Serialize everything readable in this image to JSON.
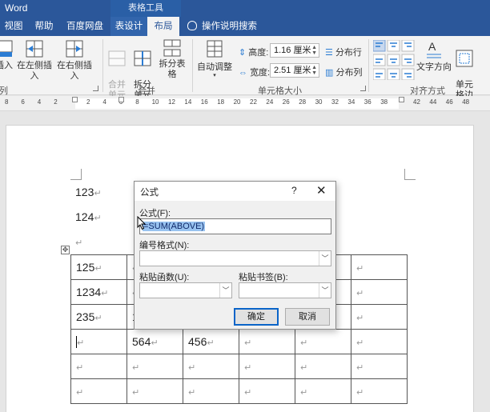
{
  "titlebar": {
    "app": "Word",
    "context_tab_group": "表格工具"
  },
  "tabs": [
    {
      "label": "视图"
    },
    {
      "label": "帮助"
    },
    {
      "label": "百度网盘"
    },
    {
      "label": "表设计"
    },
    {
      "label": "布局"
    }
  ],
  "tell_me": "操作说明搜索",
  "ribbon": {
    "insert_partial": "插入",
    "insert_left": "在左侧插入",
    "insert_right": "在右侧插入",
    "rows_cols_partial": "列",
    "merge_cells": "合并\n单元格",
    "split_cells": "拆分\n单元格",
    "split_table": "拆分表格",
    "merge_group": "合并",
    "autofit": "自动调整",
    "height_label": "高度:",
    "height_value": "1.16 厘米",
    "width_label": "宽度:",
    "width_value": "2.51 厘米",
    "distribute_rows": "分布行",
    "distribute_cols": "分布列",
    "cell_size_group": "单元格大小",
    "text_direction": "文字方向",
    "cell_margins": "单元\n格边距",
    "alignment_group": "对齐方式"
  },
  "ruler": {
    "ticks": [
      "8",
      "6",
      "4",
      "2",
      "",
      "2",
      "4",
      "6",
      "8",
      "10",
      "12",
      "14",
      "16",
      "18",
      "20",
      "22",
      "24",
      "26",
      "28",
      "30",
      "32",
      "34",
      "36",
      "38",
      "",
      "42",
      "44",
      "46",
      "48"
    ]
  },
  "document": {
    "lines": [
      "123",
      "124",
      ""
    ],
    "table_rows": [
      [
        "125",
        "",
        "",
        "",
        "",
        ""
      ],
      [
        "1234",
        "",
        "",
        "",
        "",
        ""
      ],
      [
        "235",
        "1",
        "",
        "",
        "",
        ""
      ],
      [
        "",
        "564",
        "456",
        "",
        "",
        ""
      ],
      [
        "",
        "",
        "",
        "",
        "",
        ""
      ],
      [
        "",
        "",
        "",
        "",
        "",
        ""
      ]
    ],
    "para_mark": "↵"
  },
  "dialog": {
    "title": "公式",
    "help": "?",
    "close": "✕",
    "formula_label": "公式(F):",
    "formula_value": "=SUM(ABOVE)",
    "number_format_label": "编号格式(N):",
    "number_format_value": "",
    "paste_function_label": "粘贴函数(U):",
    "paste_function_value": "",
    "paste_bookmark_label": "粘贴书签(B):",
    "paste_bookmark_value": "",
    "ok": "确定",
    "cancel": "取消"
  },
  "colors": {
    "accent": "#2b579a",
    "selection": "#99c3f0",
    "default_button_border": "#0a64c8"
  }
}
